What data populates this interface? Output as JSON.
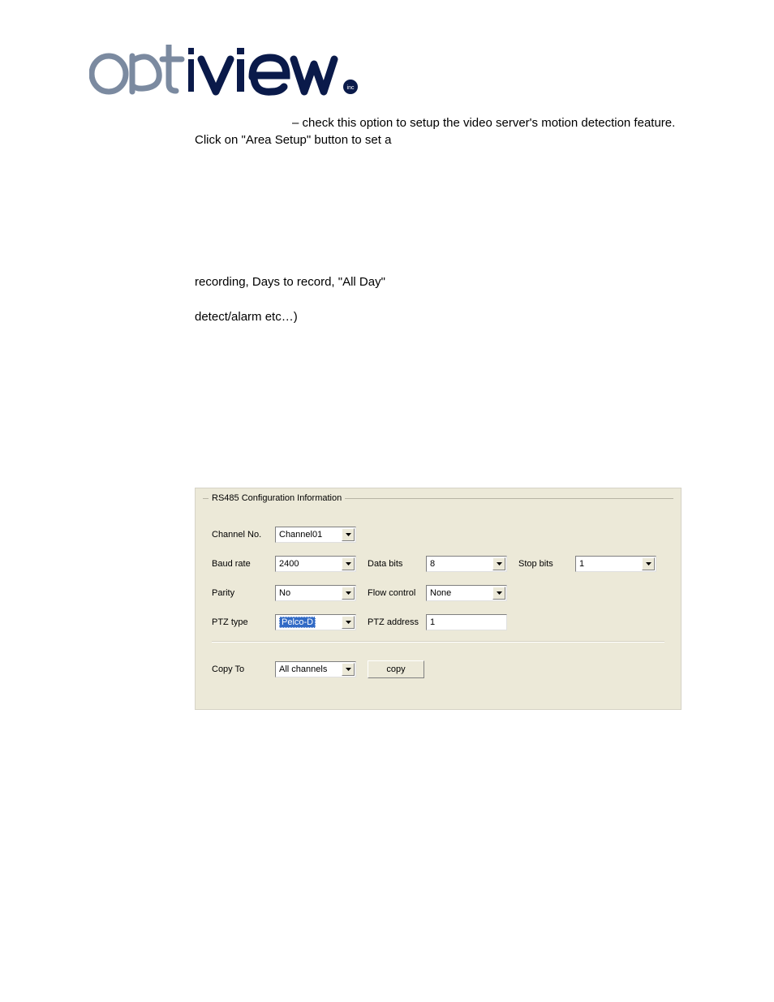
{
  "logo": {
    "brand_part1": "opt",
    "brand_i": "I",
    "brand_part2": "view",
    "suffix": "inc"
  },
  "text": {
    "p1": "– check this option to setup the video server's motion detection feature. Click on \"Area Setup\" button to set a",
    "p2": "recording, Days to record, \"All Day\"",
    "p3": "detect/alarm etc…)"
  },
  "panel": {
    "legend": "RS485 Configuration Information",
    "labels": {
      "channel": "Channel No.",
      "baud": "Baud rate",
      "databits": "Data bits",
      "stopbits": "Stop bits",
      "parity": "Parity",
      "flow": "Flow control",
      "ptztype": "PTZ type",
      "ptzaddr": "PTZ address",
      "copyto": "Copy To",
      "copybtn": "copy"
    },
    "values": {
      "channel": "Channel01",
      "baud": "2400",
      "databits": "8",
      "stopbits": "1",
      "parity": "No",
      "flow": "None",
      "ptztype": "Pelco-D",
      "ptzaddr": "1",
      "copyto": "All channels"
    }
  }
}
